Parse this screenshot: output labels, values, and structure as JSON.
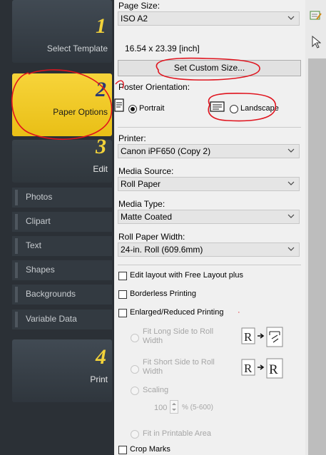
{
  "sidebar": {
    "steps": [
      {
        "num": "1",
        "label": "Select Template"
      },
      {
        "num": "2",
        "label": "Paper Options"
      },
      {
        "num": "3",
        "label": "Edit"
      },
      {
        "num": "4",
        "label": "Print"
      }
    ],
    "sub_items": [
      "Photos",
      "Clipart",
      "Text",
      "Shapes",
      "Backgrounds",
      "Variable Data"
    ]
  },
  "panel": {
    "page_size_label": "Page Size:",
    "page_size_value": "ISO A2",
    "page_dimensions": "16.54 x 23.39 [inch]",
    "set_custom_size": "Set Custom Size...",
    "orientation_label": "Poster Orientation:",
    "portrait": "Portrait",
    "landscape": "Landscape",
    "printer_label": "Printer:",
    "printer_value": "Canon iPF650 (Copy 2)",
    "media_source_label": "Media Source:",
    "media_source_value": "Roll Paper",
    "media_type_label": "Media Type:",
    "media_type_value": "Matte Coated",
    "roll_width_label": "Roll Paper Width:",
    "roll_width_value": "24-in. Roll (609.6mm)",
    "free_layout": "Edit layout with Free Layout plus",
    "borderless": "Borderless Printing",
    "enlarged": "Enlarged/Reduced Printing",
    "fit_long_1": "Fit Long Side to Roll",
    "fit_long_2": "Width",
    "fit_short_1": "Fit Short Side to Roll",
    "fit_short_2": "Width",
    "scaling": "Scaling",
    "scaling_value": "100",
    "scaling_range": "% (5-600)",
    "fit_printable": "Fit in Printable Area",
    "crop_marks": "Crop Marks"
  },
  "colors": {
    "sidebar_bg": "#2b3036",
    "active_step": "#f2cc2c",
    "step_number": "#f2d23a",
    "annotation": "#e0141e"
  }
}
